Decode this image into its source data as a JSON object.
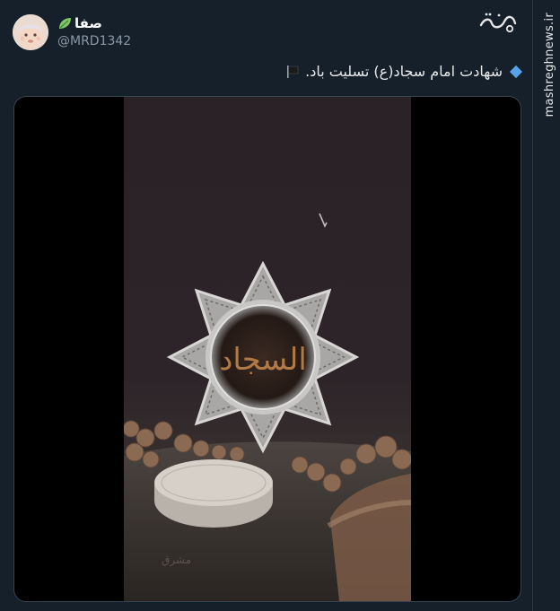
{
  "tweet": {
    "display_name": "صفا",
    "handle": "@MRD1342",
    "text": "شهادت امام سجاد(ع) تسلیت باد."
  },
  "watermark": {
    "logo_text": "مشرق",
    "url": "mashreghnews.ir"
  },
  "media": {
    "calligraphy": "السجاد"
  },
  "colors": {
    "background": "#15202b",
    "accent": "#5aa2e8"
  }
}
